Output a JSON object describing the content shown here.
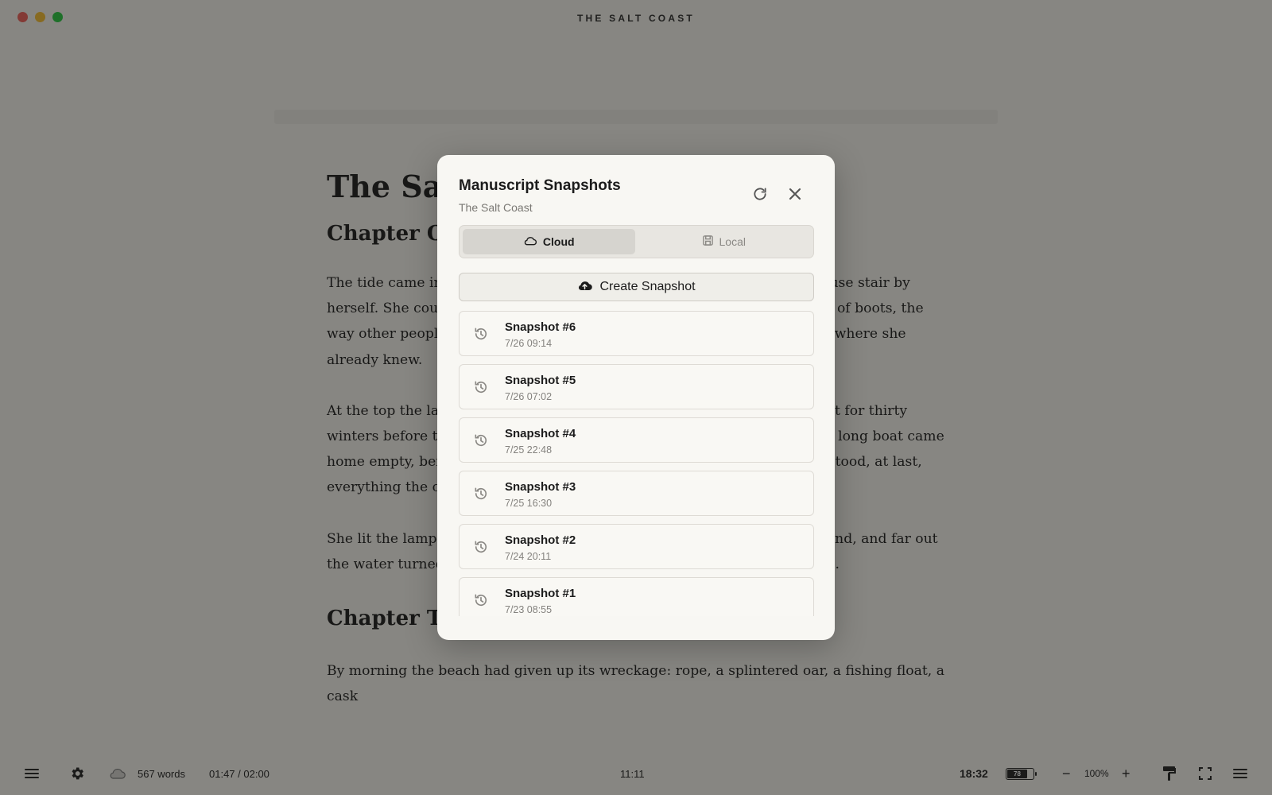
{
  "window": {
    "title": "THE SALT COAST"
  },
  "manuscript": {
    "title": "The Salt Coast",
    "chapter_one": "Chapter One",
    "paragraphs": [
      "The tide came in grey the morning Ada Merrow first climbed the lighthouse stair by herself. She counted the stone steps, worn to shallow bowls by a century of boots, the way other people counted prayers, as if the number would lead her somewhere she already knew.",
      "At the top the lamp waited, brass and cold. Her grandfather had tended it for thirty winters before the fever took him, before the sea took the Merrow or the long boat came home empty, before his hands shook too badly to trim a wick. She understood, at last, everything the counting meant.",
      "She lit the lamp. Below her the village woke, chimney smoke leaning inland, and far out the water turned slowly, patient and enormous, keeping its own accounts."
    ],
    "chapter_two": "Chapter Two — Tidewrack",
    "chapter_two_opening": "By morning the beach had given up its wreckage: rope, a splintered oar, a fishing float, a cask"
  },
  "statusbar": {
    "word_count": "567 words",
    "session_timer": "01:47 / 02:00",
    "center_time": "11:11",
    "clock": "18:32",
    "battery_percent": 78,
    "battery_label": "78",
    "zoom_minus": "−",
    "zoom_level": "100%",
    "zoom_plus": "+"
  },
  "modal": {
    "title": "Manuscript Snapshots",
    "subtitle": "The Salt Coast",
    "tabs": [
      {
        "label": "Cloud",
        "active": true,
        "icon": "cloud-icon"
      },
      {
        "label": "Local",
        "active": false,
        "icon": "save-icon"
      }
    ],
    "create_label": "Create Snapshot",
    "snapshots": [
      {
        "name": "Snapshot #6",
        "date": "7/26 09:14"
      },
      {
        "name": "Snapshot #5",
        "date": "7/26 07:02"
      },
      {
        "name": "Snapshot #4",
        "date": "7/25 22:48"
      },
      {
        "name": "Snapshot #3",
        "date": "7/25 16:30"
      },
      {
        "name": "Snapshot #2",
        "date": "7/24 20:11"
      },
      {
        "name": "Snapshot #1",
        "date": "7/23 08:55"
      }
    ]
  },
  "colors": {
    "background": "#f5f3ee",
    "modal": "#f8f7f3",
    "overlay": "rgba(20,20,18,0.49)",
    "tab_active": "#d6d4cf"
  }
}
